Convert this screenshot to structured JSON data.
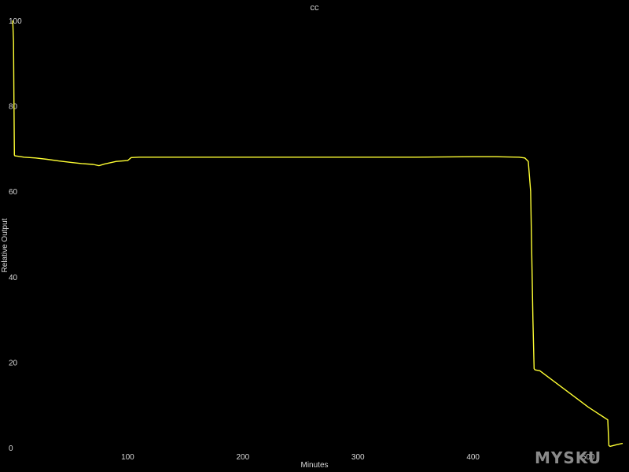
{
  "chart_data": {
    "type": "line",
    "title": "cc",
    "xlabel": "Minutes",
    "ylabel": "Relative Output",
    "xlim": [
      0,
      530
    ],
    "ylim": [
      0,
      100
    ],
    "x_ticks": [
      100,
      200,
      300,
      400,
      500
    ],
    "x_tick_labels": [
      "100",
      "200",
      "300",
      "400",
      "500"
    ],
    "y_ticks": [
      0,
      20,
      40,
      60,
      80,
      100
    ],
    "y_tick_labels": [
      "0",
      "20",
      "40",
      "60",
      "80",
      "100"
    ],
    "grid": false,
    "legend": false,
    "background_color": "#000000",
    "line_color": "#ffff33",
    "text_color": "#d9d9d9",
    "series": [
      {
        "x": [
          0,
          0.3,
          0.8,
          1.2,
          1.6,
          2,
          5,
          10,
          20,
          30,
          40,
          50,
          60,
          70,
          75,
          80,
          85,
          90,
          100,
          103,
          110,
          150,
          200,
          250,
          300,
          350,
          400,
          420,
          440,
          445,
          448,
          450,
          452,
          453,
          453.5,
          454,
          458,
          500,
          517,
          518,
          519,
          525,
          530
        ],
        "y": [
          100,
          99,
          95,
          80,
          68.5,
          68.3,
          68.2,
          68,
          67.8,
          67.5,
          67.1,
          66.8,
          66.5,
          66.3,
          66.0,
          66.4,
          66.7,
          67.0,
          67.2,
          67.9,
          68,
          68,
          68,
          68,
          68,
          68,
          68.1,
          68.1,
          68.0,
          67.8,
          67.0,
          60,
          30,
          18.5,
          18.3,
          18.2,
          18.0,
          9.5,
          6.5,
          0.5,
          0.3,
          0.7,
          1.0
        ]
      }
    ]
  },
  "watermark": "MYSKU"
}
